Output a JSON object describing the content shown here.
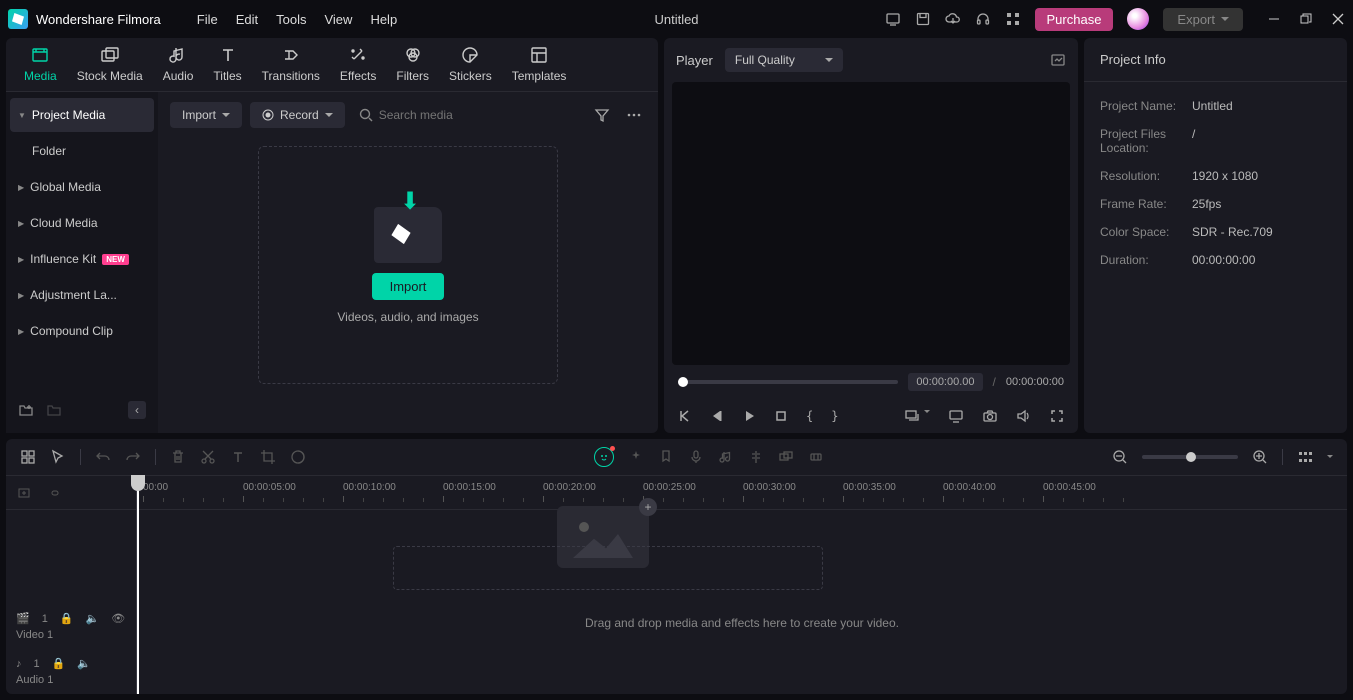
{
  "app": {
    "title": "Wondershare Filmora",
    "document": "Untitled"
  },
  "menu": [
    "File",
    "Edit",
    "Tools",
    "View",
    "Help"
  ],
  "titlebar": {
    "purchase": "Purchase",
    "export": "Export"
  },
  "categories": [
    {
      "id": "media",
      "label": "Media"
    },
    {
      "id": "stock",
      "label": "Stock Media"
    },
    {
      "id": "audio",
      "label": "Audio"
    },
    {
      "id": "titles",
      "label": "Titles"
    },
    {
      "id": "transitions",
      "label": "Transitions"
    },
    {
      "id": "effects",
      "label": "Effects"
    },
    {
      "id": "filters",
      "label": "Filters"
    },
    {
      "id": "stickers",
      "label": "Stickers"
    },
    {
      "id": "templates",
      "label": "Templates"
    }
  ],
  "sidebar": {
    "items": [
      {
        "label": "Project Media",
        "type": "expand",
        "active": true
      },
      {
        "label": "Folder",
        "type": "child"
      },
      {
        "label": "Global Media",
        "type": "expand"
      },
      {
        "label": "Cloud Media",
        "type": "expand"
      },
      {
        "label": "Influence Kit",
        "type": "expand",
        "badge": "NEW"
      },
      {
        "label": "Adjustment La...",
        "type": "expand"
      },
      {
        "label": "Compound Clip",
        "type": "expand"
      }
    ]
  },
  "mediaToolbar": {
    "import": "Import",
    "record": "Record",
    "searchPlaceholder": "Search media"
  },
  "dropZone": {
    "import": "Import",
    "caption": "Videos, audio, and images"
  },
  "player": {
    "label": "Player",
    "quality": "Full Quality",
    "currentTime": "00:00:00.00",
    "totalTime": "00:00:00:00"
  },
  "projectInfo": {
    "title": "Project Info",
    "rows": [
      {
        "label": "Project Name:",
        "value": "Untitled"
      },
      {
        "label": "Project Files Location:",
        "value": "/"
      },
      {
        "label": "Resolution:",
        "value": "1920 x 1080"
      },
      {
        "label": "Frame Rate:",
        "value": "25fps"
      },
      {
        "label": "Color Space:",
        "value": "SDR - Rec.709"
      },
      {
        "label": "Duration:",
        "value": "00:00:00:00"
      }
    ]
  },
  "timeline": {
    "ruler": [
      "00:00",
      "00:00:05:00",
      "00:00:10:00",
      "00:00:15:00",
      "00:00:20:00",
      "00:00:25:00",
      "00:00:30:00",
      "00:00:35:00",
      "00:00:40:00",
      "00:00:45:00"
    ],
    "tracks": [
      {
        "type": "video",
        "label": "Video 1",
        "index": "1"
      },
      {
        "type": "audio",
        "label": "Audio 1",
        "index": "1"
      }
    ],
    "dropText": "Drag and drop media and effects here to create your video."
  }
}
